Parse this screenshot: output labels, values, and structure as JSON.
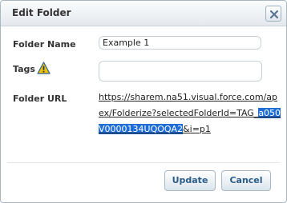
{
  "dialog": {
    "title": "Edit Folder",
    "close_icon": "close-icon"
  },
  "form": {
    "folder_name_label": "Folder Name",
    "folder_name_value": "Example 1",
    "tags_label": "Tags",
    "tags_icon": "warning-icon",
    "tags_value": "",
    "folder_url_label": "Folder URL",
    "folder_url_plain": "https://sharem.na51.visual.force.com/apex/Folderize?selectedFolderId=TAG_",
    "folder_url_selected": "a050V0000134UQOQA2",
    "folder_url_suffix": "&i=p1"
  },
  "buttons": {
    "update_label": "Update",
    "cancel_label": "Cancel"
  },
  "colors": {
    "selection": "#1f6dd6",
    "button_text": "#2b5d8a",
    "warning": "#f2c200"
  }
}
